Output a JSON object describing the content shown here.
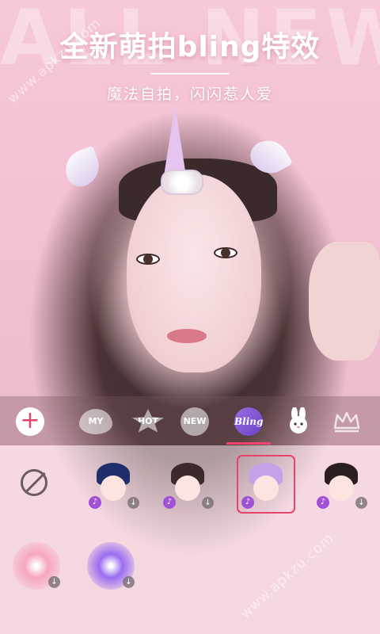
{
  "background_text": "ALL NEW",
  "headline": "全新萌拍bling特效",
  "subheadline": "魔法自拍，闪闪惹人爱",
  "watermarks": [
    "www.apkzu.com",
    "www.apkzu.com"
  ],
  "toolbar": {
    "add_icon": "+",
    "categories": [
      {
        "label": "MY",
        "icon": "heart-icon"
      },
      {
        "label": "HOT",
        "icon": "star-icon"
      },
      {
        "label": "NEW",
        "icon": "circle-icon"
      },
      {
        "label": "Bling",
        "icon": "bling-icon",
        "selected": true
      },
      {
        "label": "",
        "icon": "bunny-icon"
      },
      {
        "label": "",
        "icon": "crown-icon"
      }
    ]
  },
  "effects": [
    {
      "name": "none",
      "icon": "no-effect-icon"
    },
    {
      "name": "blue-hair-avatar",
      "music": "♪",
      "download": "↓"
    },
    {
      "name": "bun-hair-avatar",
      "music": "♪",
      "download": "↓"
    },
    {
      "name": "unicorn-avatar",
      "music": "♪",
      "selected": true
    },
    {
      "name": "cat-ear-avatar",
      "music": "♪",
      "download": "↓"
    },
    {
      "name": "pink-sparkle",
      "download": "↓"
    },
    {
      "name": "purple-sparkle",
      "download": "↓"
    }
  ],
  "colors": {
    "accent": "#e8436a",
    "bling": "#7b4fd4",
    "background": "#f4c9d8"
  }
}
